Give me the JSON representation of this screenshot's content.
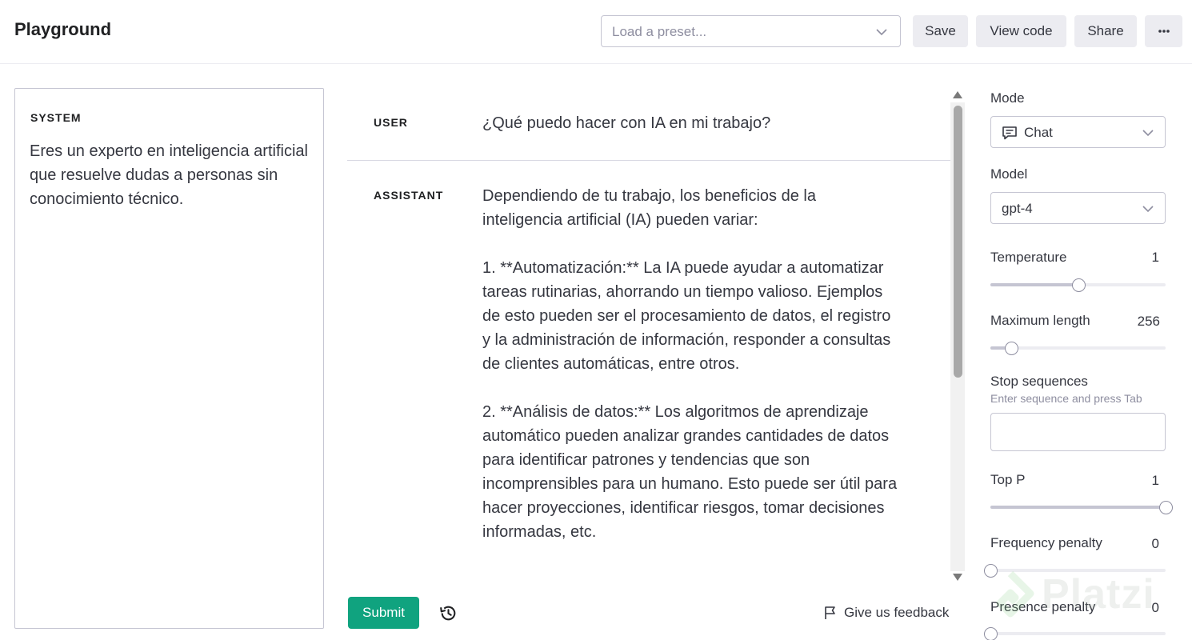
{
  "header": {
    "title": "Playground",
    "preset_placeholder": "Load a preset...",
    "save_label": "Save",
    "view_code_label": "View code",
    "share_label": "Share",
    "more_label": "⋯"
  },
  "system": {
    "label": "SYSTEM",
    "text": "Eres un experto en inteligencia artificial que resuelve dudas a personas sin conocimiento técnico."
  },
  "conversation": [
    {
      "role": "USER",
      "text": "¿Qué puedo hacer con IA en mi trabajo?"
    },
    {
      "role": "ASSISTANT",
      "text": "Dependiendo de tu trabajo, los beneficios de la inteligencia artificial (IA) pueden variar:\n\n1. **Automatización:** La IA puede ayudar a automatizar tareas rutinarias, ahorrando un tiempo valioso. Ejemplos de esto pueden ser el procesamiento de datos, el registro y la administración de información, responder a consultas de clientes automáticas, entre otros.\n\n2. **Análisis de datos:** Los algoritmos de aprendizaje automático pueden analizar grandes cantidades de datos para identificar patrones y tendencias que son incomprensibles para un humano. Esto puede ser útil para hacer proyecciones, identificar riesgos, tomar decisiones informadas, etc."
    }
  ],
  "footer": {
    "submit_label": "Submit",
    "feedback_label": "Give us feedback"
  },
  "settings": {
    "mode_label": "Mode",
    "mode_value": "Chat",
    "model_label": "Model",
    "model_value": "gpt-4",
    "temperature": {
      "label": "Temperature",
      "value": "1",
      "fraction": 0.5
    },
    "max_length": {
      "label": "Maximum length",
      "value": "256",
      "fraction": 0.12
    },
    "stop_sequences": {
      "label": "Stop sequences",
      "hint": "Enter sequence and press Tab"
    },
    "top_p": {
      "label": "Top P",
      "value": "1",
      "fraction": 1.0
    },
    "frequency_penalty": {
      "label": "Frequency penalty",
      "value": "0",
      "fraction": 0.0
    },
    "presence_penalty": {
      "label": "Presence penalty",
      "value": "0",
      "fraction": 0.0
    }
  },
  "watermark": "Platzi",
  "colors": {
    "accent": "#10a37f",
    "button_bg": "#ececf1",
    "border": "#c5c5d2"
  }
}
